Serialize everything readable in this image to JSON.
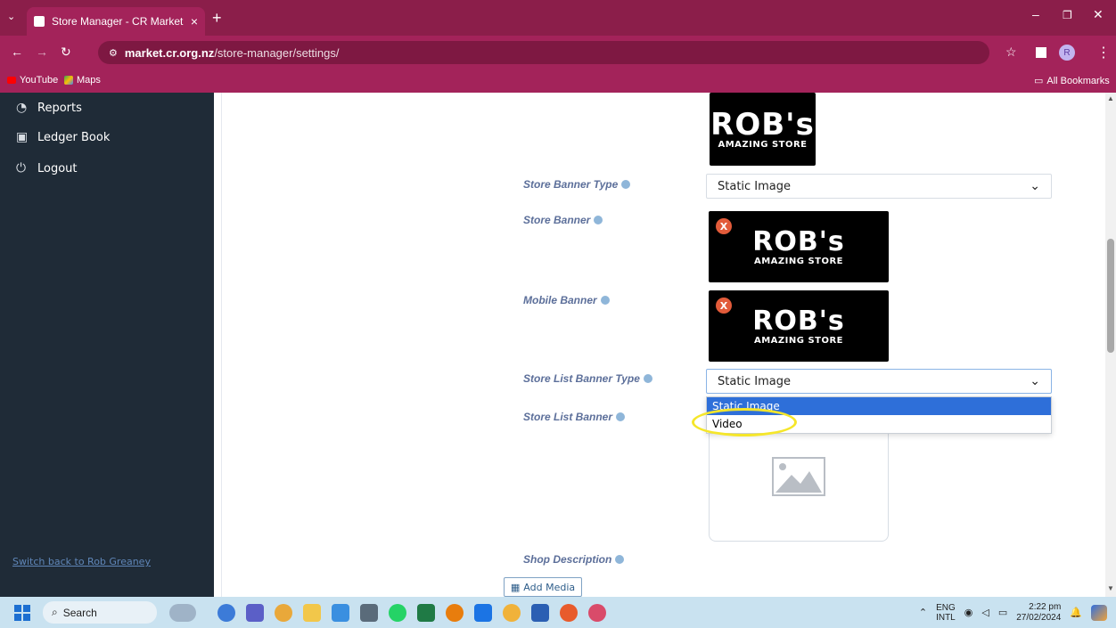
{
  "browser": {
    "tab_title": "Store Manager - CR Market",
    "tab_close": "×",
    "new_tab": "+",
    "url_host": "market.cr.org.nz",
    "url_path": "/store-manager/settings/",
    "bookmarks": [
      "YouTube",
      "Maps"
    ],
    "all_bookmarks": "All Bookmarks",
    "profile_initial": "R"
  },
  "sidebar": {
    "items": [
      {
        "label": "Reports",
        "icon": "pie-chart-icon"
      },
      {
        "label": "Ledger Book",
        "icon": "money-icon"
      },
      {
        "label": "Logout",
        "icon": "power-icon"
      }
    ],
    "switch_link": "Switch back to Rob Greaney"
  },
  "main": {
    "store_banner_type": {
      "label": "Store Banner Type",
      "value": "Static Image"
    },
    "store_banner": {
      "label": "Store Banner",
      "line1": "ROB's",
      "line2": "AMAZING STORE"
    },
    "mobile_banner": {
      "label": "Mobile Banner",
      "line1": "ROB's",
      "line2": "AMAZING STORE"
    },
    "logo_top": {
      "line1": "ROB's",
      "line2": "AMAZING STORE"
    },
    "store_list_banner_type": {
      "label": "Store List Banner Type",
      "value": "Static Image"
    },
    "dropdown_options": [
      "Static Image",
      "Video"
    ],
    "store_list_banner": {
      "label": "Store List Banner"
    },
    "shop_description": {
      "label": "Shop Description"
    },
    "add_media": "Add Media",
    "remove_x": "X"
  },
  "taskbar": {
    "search": "Search",
    "lang1": "ENG",
    "lang2": "INTL",
    "time": "2:22 pm",
    "date": "27/02/2024"
  },
  "colors": {
    "browser_accent": "#a3235a",
    "sidebar_bg": "#1f2b37",
    "label_color": "#5c6f9a",
    "selected_option": "#2e6fd9",
    "highlight_circle": "#f5e62a"
  }
}
